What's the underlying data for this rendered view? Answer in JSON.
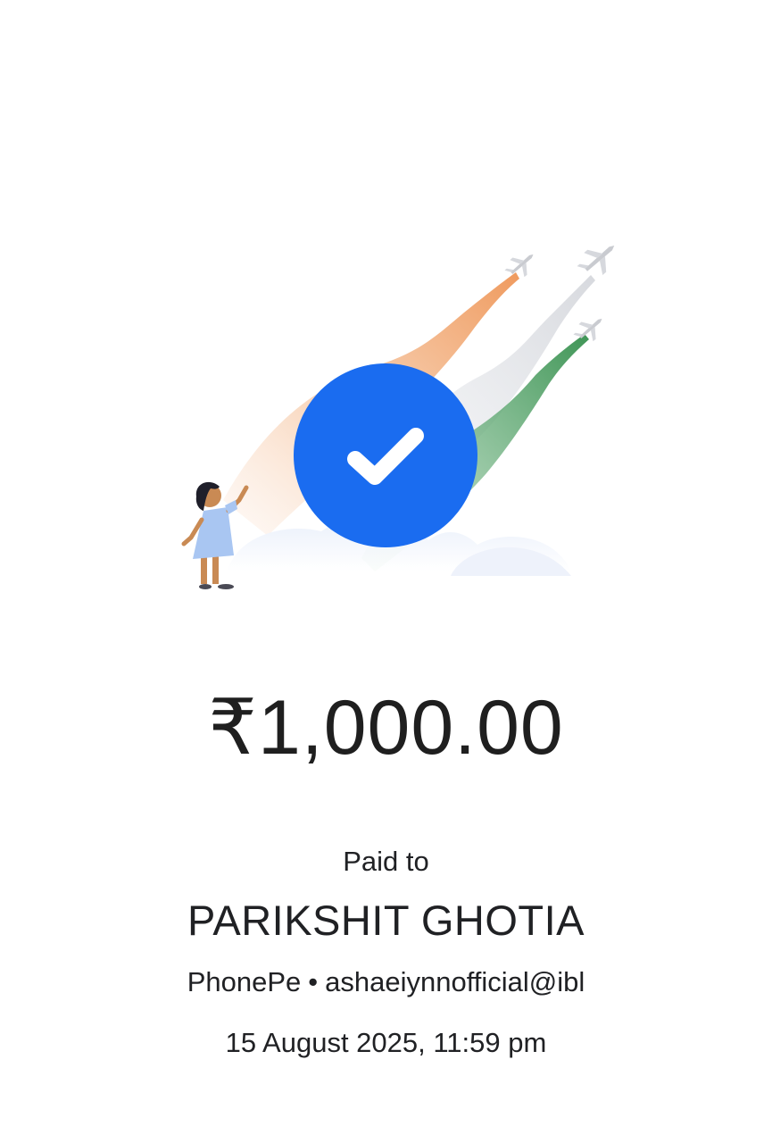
{
  "status": {
    "icon": "check-circle-icon",
    "accent_color": "#1a6cf0"
  },
  "payment": {
    "amount": "₹1,000.00",
    "paid_to_label": "Paid to",
    "payee_name": "PARIKSHIT GHOTIA",
    "payee_app": "PhonePe",
    "separator": "•",
    "payee_upi_id": "ashaeiynnofficial@ibl",
    "datetime": "15 August 2025, 11:59 pm"
  },
  "illustration": {
    "theme": "independence-day-flypast",
    "colors": {
      "saffron": "#f0a067",
      "white_trail": "#dfe1e6",
      "green": "#4f9e63",
      "cloud": "#eef2fa"
    }
  }
}
